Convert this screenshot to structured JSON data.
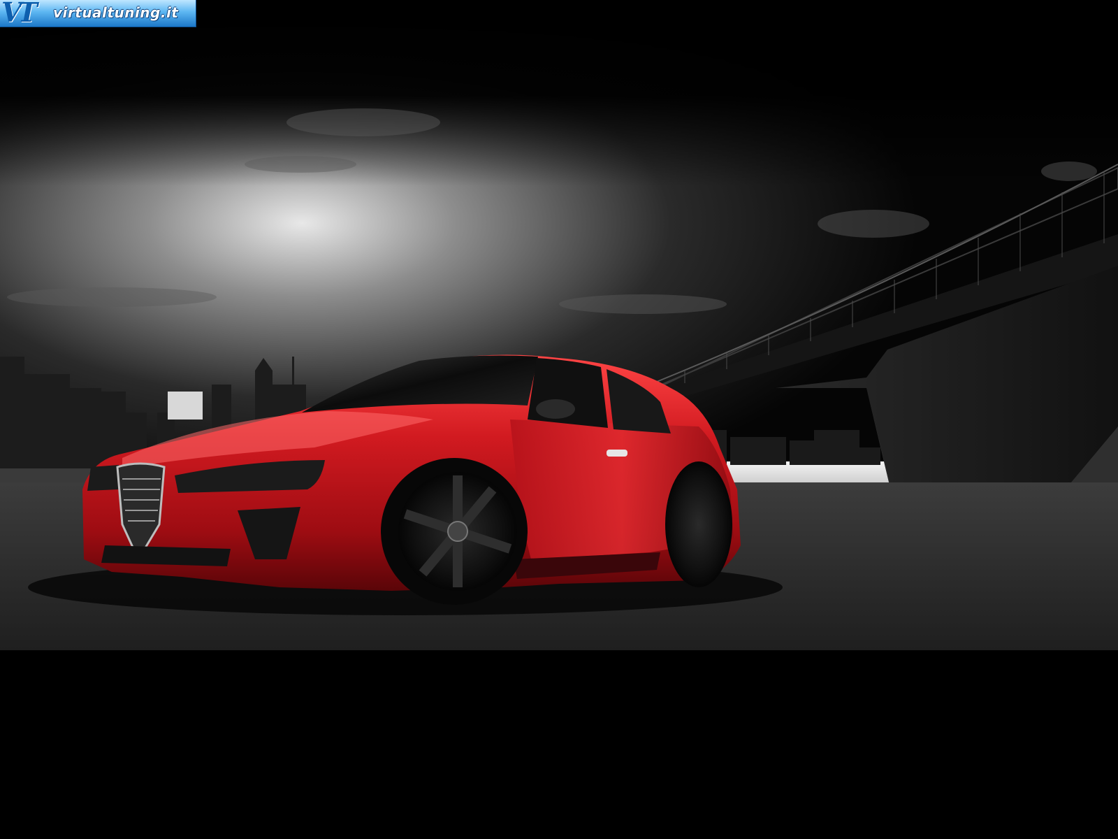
{
  "watermark": {
    "brand_mark": "VT",
    "brand_name": "virtualtuning.it",
    "colors": {
      "banner_top": "#bfe6ff",
      "banner_bottom": "#1c78c8",
      "text": "#ffffff"
    }
  },
  "scene": {
    "subject": "car-illustration",
    "colors": {
      "car_body": "#c0141c",
      "car_highlight": "#ff4a4a",
      "sky": "#141414",
      "ground": "#1a1a1a",
      "water": "#dcdcdc"
    }
  }
}
